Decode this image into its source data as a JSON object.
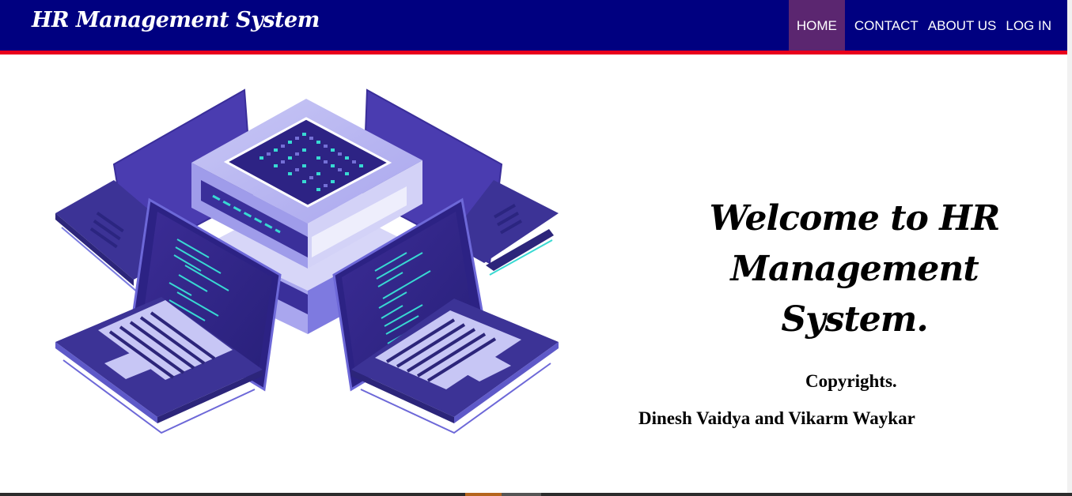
{
  "header": {
    "brand": "HR Management System",
    "nav": [
      {
        "label": "HOME",
        "active": true
      },
      {
        "label": "CONTACT",
        "active": false
      },
      {
        "label": "ABOUT US",
        "active": false
      },
      {
        "label": "LOG IN",
        "active": false
      }
    ],
    "colors": {
      "background": "#000080",
      "accent_border": "#e8001c",
      "active_item": "#5b2670"
    }
  },
  "main": {
    "welcome_line1": "Welcome to HR",
    "welcome_line2": "Management System.",
    "copyright": "Copyrights.",
    "authors": "Dinesh Vaidya and Vikarm Waykar",
    "illustration_icon": "isometric-server-laptops-illustration"
  }
}
